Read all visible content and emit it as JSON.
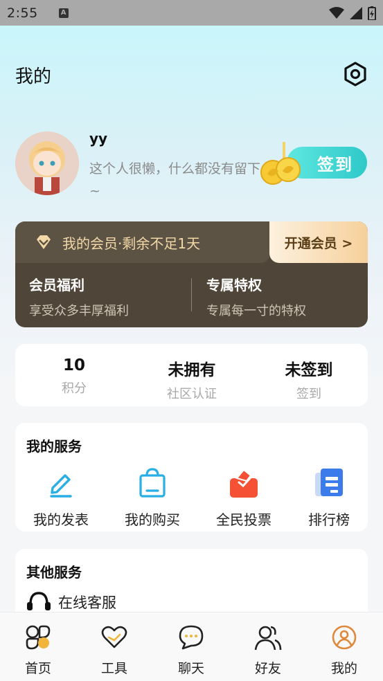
{
  "status_bar": {
    "time": "2:55",
    "notif_letter": "A"
  },
  "header": {
    "title": "我的"
  },
  "profile": {
    "username": "yy",
    "bio": "这个人很懒，什么都没有留下~",
    "checkin_label": "签到"
  },
  "vip": {
    "status": "我的会员·剩余不足1天",
    "open_label": "开通会员 >",
    "benefit_title": "会员福利",
    "benefit_sub": "享受众多丰厚福利",
    "privilege_title": "专属特权",
    "privilege_sub": "专属每一寸的特权"
  },
  "stats": [
    {
      "value": "10",
      "label": "积分"
    },
    {
      "value": "未拥有",
      "label": "社区认证"
    },
    {
      "value": "未签到",
      "label": "签到"
    }
  ],
  "my_services": {
    "title": "我的服务",
    "items": [
      {
        "label": "我的发表",
        "icon": "pen-icon"
      },
      {
        "label": "我的购买",
        "icon": "shopping-bag-icon"
      },
      {
        "label": "全民投票",
        "icon": "vote-box-icon"
      },
      {
        "label": "排行榜",
        "icon": "ranking-icon"
      }
    ]
  },
  "other_services": {
    "title": "其他服务",
    "online_service": "在线客服"
  },
  "tabbar": [
    {
      "label": "首页",
      "icon": "home-grid-icon"
    },
    {
      "label": "工具",
      "icon": "heart-icon"
    },
    {
      "label": "聊天",
      "icon": "chat-bubble-icon"
    },
    {
      "label": "好友",
      "icon": "friends-icon"
    },
    {
      "label": "我的",
      "icon": "profile-icon",
      "active": true
    }
  ],
  "colors": {
    "accent": "#2ec9c9",
    "vip_bg": "#4f4538",
    "vip_gold": "#f3d9a8",
    "active_tab": "#e0883a"
  }
}
